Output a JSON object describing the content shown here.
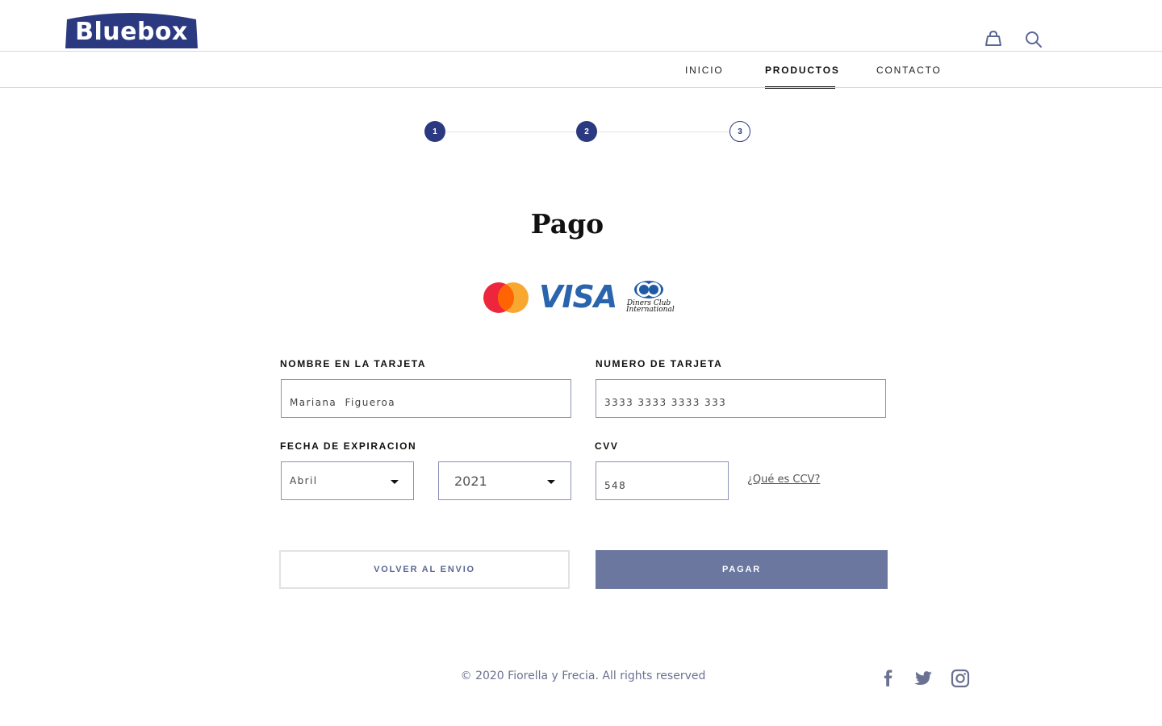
{
  "brand": {
    "logo_text": "Bluebox",
    "color": "#2b3a80"
  },
  "header": {
    "cart_icon": "shopping-bag-icon",
    "search_icon": "search-icon"
  },
  "nav": {
    "items": [
      {
        "label": "INICIO",
        "active": false
      },
      {
        "label": "PRODUCTOS",
        "active": true
      },
      {
        "label": "CONTACTO",
        "active": false
      }
    ]
  },
  "stepper": {
    "steps": [
      {
        "label": "1",
        "state": "done"
      },
      {
        "label": "2",
        "state": "done"
      },
      {
        "label": "3",
        "state": "current"
      }
    ]
  },
  "page": {
    "title": "Pago"
  },
  "payment_logos": {
    "visa": "VISA",
    "diners": "Diners Club International"
  },
  "form": {
    "card_name": {
      "label": "NOMBRE EN LA TARJETA",
      "value": "Mariana  Figueroa"
    },
    "card_number": {
      "label": "NUMERO DE TARJETA",
      "value": "3333 3333 3333 333"
    },
    "expiration": {
      "label": "FECHA DE EXPIRACION",
      "month": "Abril",
      "year": "2021"
    },
    "cvv": {
      "label": "CVV",
      "value": "548",
      "help_link": "¿Qué es CCV?"
    }
  },
  "actions": {
    "back_label": "VOLVER AL ENVIO",
    "pay_label": "PAGAR"
  },
  "footer": {
    "copyright": "© 2020 Fiorella y Frecia. All rights reserved",
    "social": [
      "facebook-icon",
      "twitter-icon",
      "instagram-icon"
    ]
  }
}
